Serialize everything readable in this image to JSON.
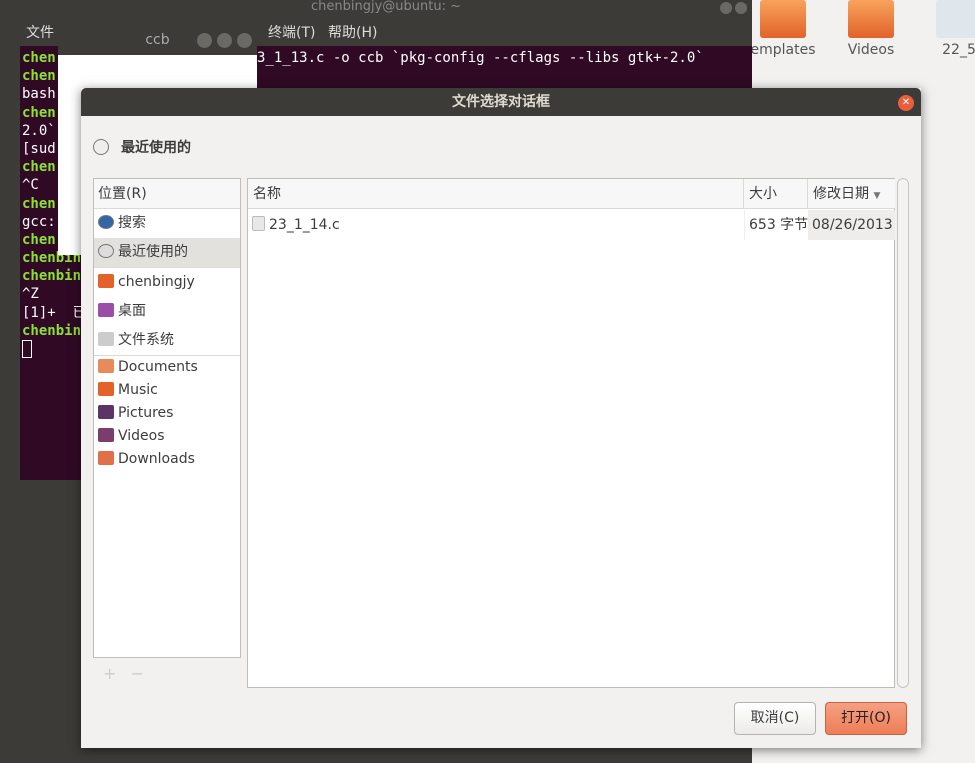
{
  "desktop": {
    "icons": [
      {
        "label": "emplates"
      },
      {
        "label": "Videos"
      },
      {
        "label": "22_5"
      }
    ]
  },
  "terminal": {
    "title": "chenbingjy@ubuntu: ~",
    "menu_left": "文件",
    "menu_right": [
      "终端(T)",
      "帮助(H)"
    ],
    "lines": [
      {
        "left": "chen",
        "g": true,
        "right": "3_1_13.c -o ccb `pkg-config --cflags --libs gtk+-2.0`"
      },
      {
        "left": "chen",
        "g": true,
        "right": ""
      },
      {
        "left": "bash",
        "g": false,
        "right": ""
      },
      {
        "left": "chen",
        "g": true,
        "right": ""
      },
      {
        "left": "2.0`",
        "g": false,
        "right": ""
      },
      {
        "left": "[sud",
        "g": false,
        "right": ""
      },
      {
        "left": "chen",
        "g": true,
        "right": ""
      },
      {
        "left": "^C",
        "g": false,
        "right": ""
      },
      {
        "left": "chen",
        "g": true,
        "right": ""
      },
      {
        "left": "gcc:",
        "g": false,
        "right": ""
      },
      {
        "left": "chen",
        "g": true,
        "right": ""
      },
      {
        "left": "chenbin",
        "g": true,
        "right": ""
      },
      {
        "left": "chenbin",
        "g": true,
        "right": ""
      },
      {
        "left": "^Z",
        "g": false,
        "right": ""
      },
      {
        "left": "[1]+  已",
        "g": false,
        "right": ""
      },
      {
        "left": "chenbin",
        "g": true,
        "right": ""
      }
    ]
  },
  "ccb_window": {
    "title": "ccb"
  },
  "dialog": {
    "title": "文件选择对话框",
    "location": "最近使用的",
    "places_header": "位置(R)",
    "places": [
      {
        "label": "搜索",
        "icon": "search-icon"
      },
      {
        "label": "最近使用的",
        "icon": "recent-icon",
        "selected": true
      },
      {
        "label": "chenbingjy",
        "icon": "home-folder-icon"
      },
      {
        "label": "桌面",
        "icon": "desktop-icon"
      },
      {
        "label": "文件系统",
        "icon": "drive-icon"
      },
      {
        "label": "Documents",
        "icon": "documents-folder-icon"
      },
      {
        "label": "Music",
        "icon": "music-folder-icon"
      },
      {
        "label": "Pictures",
        "icon": "pictures-folder-icon"
      },
      {
        "label": "Videos",
        "icon": "videos-folder-icon"
      },
      {
        "label": "Downloads",
        "icon": "downloads-folder-icon"
      }
    ],
    "add": "+",
    "remove": "−",
    "columns": {
      "name": "名称",
      "size": "大小",
      "modified": "修改日期"
    },
    "files": [
      {
        "name": "23_1_14.c",
        "size": "653 字节",
        "modified": "08/26/2013"
      }
    ],
    "cancel": "取消(C)",
    "open": "打开(O)",
    "colors": {
      "accent": "#ef7d57",
      "titlebar": "#3c3b37",
      "terminal": "#300a24"
    }
  }
}
